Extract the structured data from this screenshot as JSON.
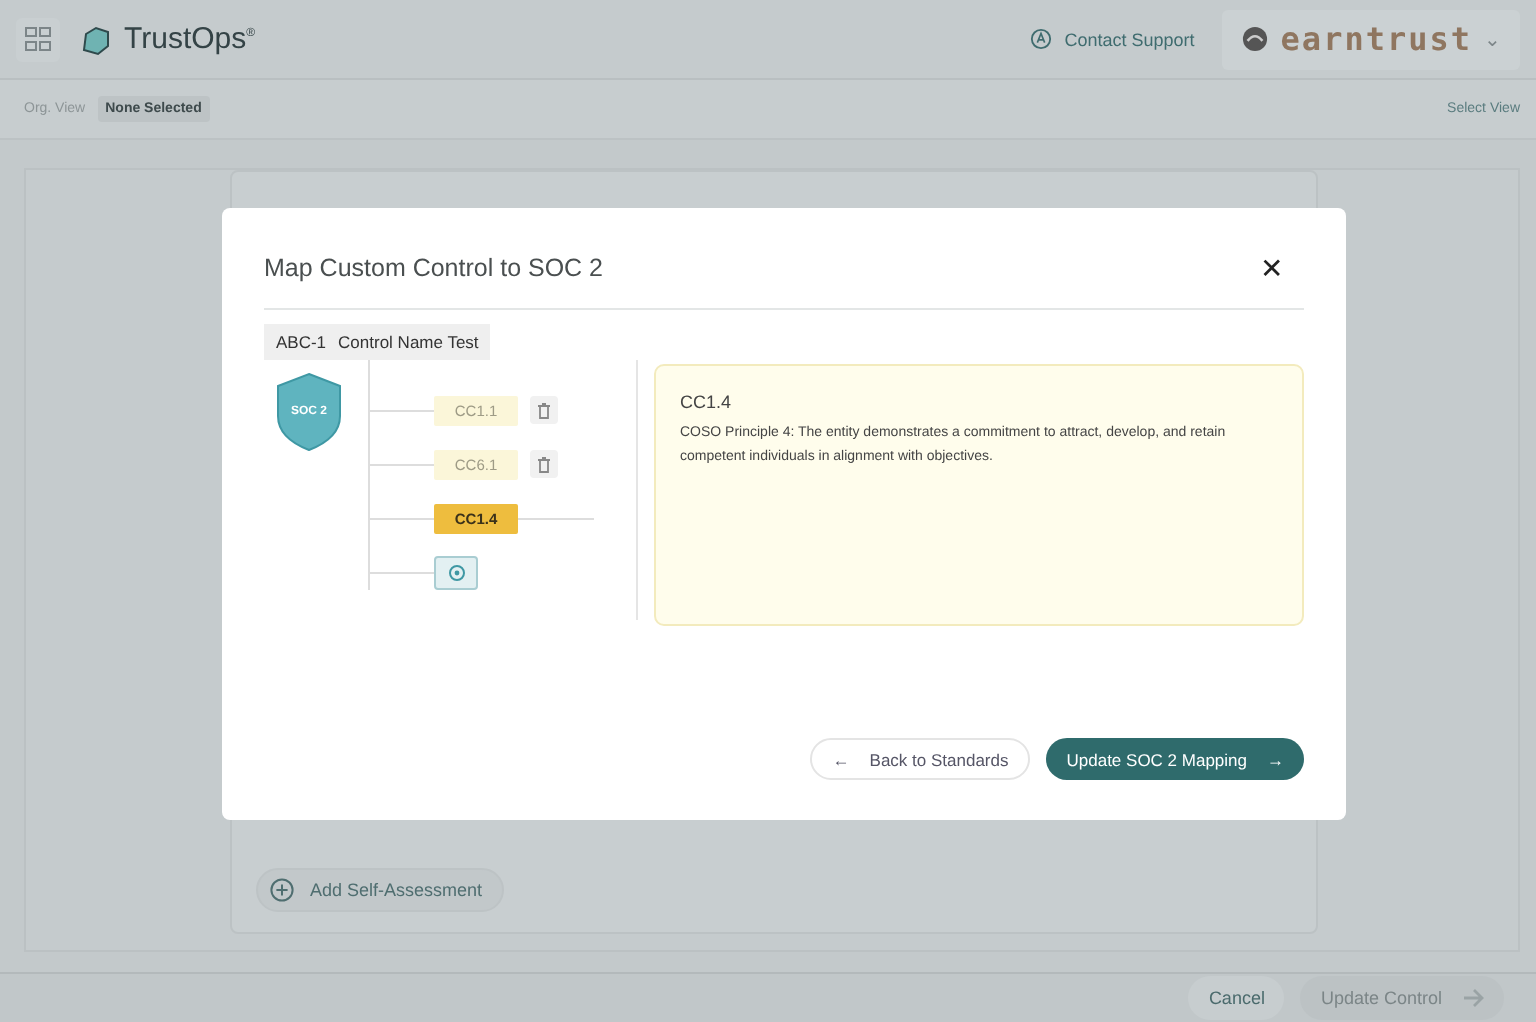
{
  "header": {
    "app_name": "TrustOps",
    "trademark": "®",
    "support_link": "Contact Support",
    "org_name": "earntrust",
    "org_caret": "⌄"
  },
  "view_bar": {
    "label": "Org. View",
    "value": "None Selected",
    "action": "Select View"
  },
  "background_card": {
    "add_button": "Add Self-Assessment"
  },
  "footer": {
    "buttons": [
      {
        "label": "Cancel",
        "disabled": false
      },
      {
        "label": "Update Control",
        "disabled": true
      }
    ]
  },
  "modal": {
    "title": "Map Custom Control to SOC 2",
    "close": "✕",
    "control": {
      "id": "ABC-1",
      "name": "Control Name Test"
    },
    "standard_badge": "SOC 2",
    "mappings": [
      {
        "label": "CC1.1",
        "selected": false
      },
      {
        "label": "CC6.1",
        "selected": false
      },
      {
        "label": "CC1.4",
        "selected": true
      }
    ],
    "detail": {
      "title": "CC1.4",
      "description": "COSO Principle 4: The entity demonstrates a commitment to attract, develop, and retain competent individuals in alignment with objectives."
    },
    "back_button": "Back to Standards",
    "back_arrow": "←",
    "primary_button": "Update SOC 2 Mapping",
    "primary_arrow": "→"
  }
}
